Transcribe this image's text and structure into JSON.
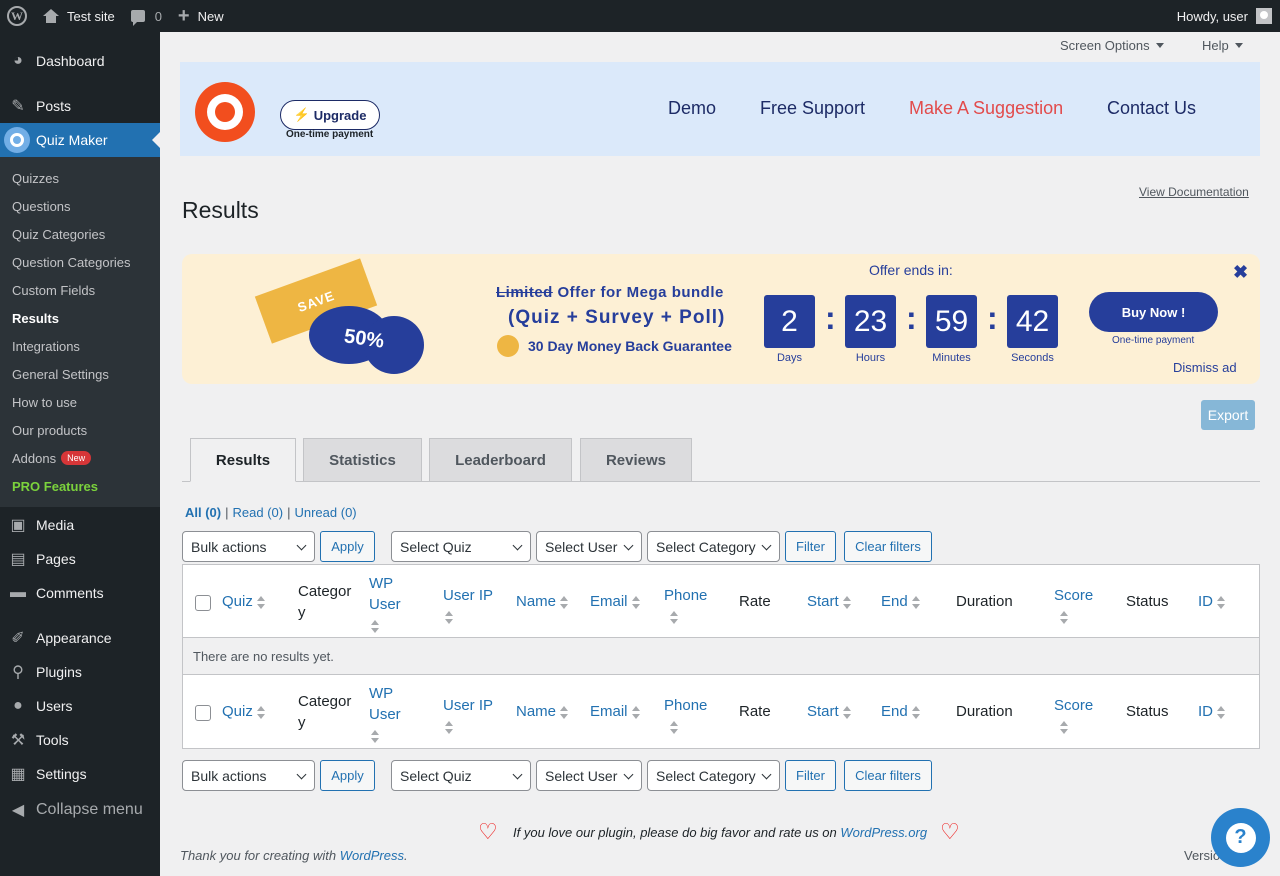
{
  "adminbar": {
    "site_name": "Test site",
    "comments_count": "0",
    "new_label": "New",
    "howdy": "Howdy, user"
  },
  "sidebar": {
    "dashboard": "Dashboard",
    "posts": "Posts",
    "quiz_maker": "Quiz Maker",
    "sub": [
      "Quizzes",
      "Questions",
      "Quiz Categories",
      "Question Categories",
      "Custom Fields",
      "Results",
      "Integrations",
      "General Settings",
      "How to use",
      "Our products",
      "Addons",
      "PRO Features"
    ],
    "addons_badge": "New",
    "media": "Media",
    "pages": "Pages",
    "comments": "Comments",
    "appearance": "Appearance",
    "plugins": "Plugins",
    "users": "Users",
    "tools": "Tools",
    "settings": "Settings",
    "collapse": "Collapse menu"
  },
  "screen_options": "Screen Options",
  "help": "Help",
  "plugin_header": {
    "upgrade": "Upgrade",
    "one_time": "One-time payment",
    "links": [
      "Demo",
      "Free Support",
      "Make A Suggestion",
      "Contact Us"
    ]
  },
  "view_documentation": "View Documentation",
  "page_title": "Results",
  "promo": {
    "save": "SAVE",
    "percent": "50%",
    "title_strike": "Limited",
    "title_rest": " Offer for Mega bundle",
    "subtitle": "(Quiz + Survey + Poll)",
    "guarantee": "30 Day Money Back Guarantee",
    "offer_ends": "Offer ends in:",
    "days": "2",
    "hours": "23",
    "minutes": "59",
    "seconds": "42",
    "days_label": "Days",
    "hours_label": "Hours",
    "minutes_label": "Minutes",
    "seconds_label": "Seconds",
    "buy": "Buy Now !",
    "buy_sub": "One-time payment",
    "dismiss": "Dismiss ad"
  },
  "export": "Export",
  "tabs": [
    "Results",
    "Statistics",
    "Leaderboard",
    "Reviews"
  ],
  "views": {
    "all": "All (0)",
    "read": "Read (0)",
    "unread": "Unread (0)",
    "sep": "|"
  },
  "controls": {
    "bulk": "Bulk actions",
    "apply": "Apply",
    "select_quiz": "Select Quiz",
    "select_user": "Select User",
    "select_category": "Select Category",
    "filter": "Filter",
    "clear": "Clear filters"
  },
  "columns": {
    "quiz": "Quiz",
    "category_1": "Categor",
    "category_2": "y",
    "wp_user_1": "WP",
    "wp_user_2": "User",
    "user_ip": "User IP",
    "name": "Name",
    "email": "Email",
    "phone": "Phone",
    "rate": "Rate",
    "start": "Start",
    "end": "End",
    "duration": "Duration",
    "score": "Score",
    "status": "Status",
    "id": "ID"
  },
  "no_results": "There are no results yet.",
  "footer": {
    "rate_text": "If you love our plugin, please do big favor and rate us on ",
    "wporg": "WordPress.org",
    "thanks": "Thank you for creating with ",
    "wordpress": "WordPress",
    "version": "Versio"
  }
}
